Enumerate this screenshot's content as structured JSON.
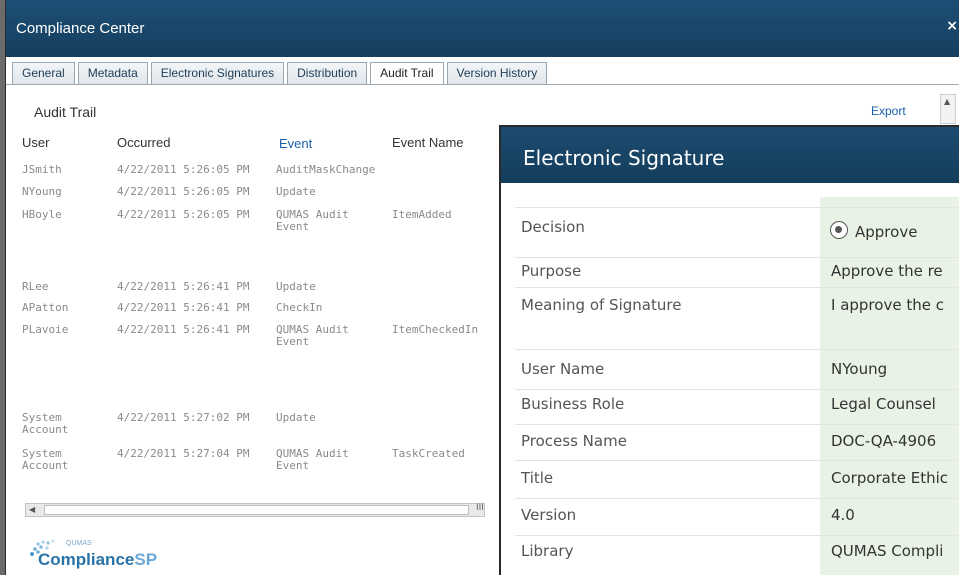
{
  "window": {
    "title": "Compliance Center",
    "close_label": "×"
  },
  "tabs": [
    {
      "label": "General"
    },
    {
      "label": "Metadata"
    },
    {
      "label": "Electronic Signatures"
    },
    {
      "label": "Distribution"
    },
    {
      "label": "Audit Trail"
    },
    {
      "label": "Version History"
    }
  ],
  "active_tab": "Audit Trail",
  "audit": {
    "title": "Audit Trail",
    "export_label": "Export",
    "columns": [
      "User",
      "Occurred",
      "Event",
      "Event Name"
    ],
    "rows": [
      {
        "user": "JSmith",
        "occurred": "4/22/2011 5:26:05 PM",
        "event": "AuditMaskChange",
        "event_name": ""
      },
      {
        "user": "NYoung",
        "occurred": "4/22/2011 5:26:05 PM",
        "event": "Update",
        "event_name": ""
      },
      {
        "user": "HBoyle",
        "occurred": "4/22/2011 5:26:05 PM",
        "event": "QUMAS Audit Event",
        "event_name": "ItemAdded"
      },
      {
        "user": "RLee",
        "occurred": "4/22/2011 5:26:41 PM",
        "event": "Update",
        "event_name": ""
      },
      {
        "user": "APatton",
        "occurred": "4/22/2011 5:26:41 PM",
        "event": "CheckIn",
        "event_name": ""
      },
      {
        "user": "PLavoie",
        "occurred": "4/22/2011 5:26:41 PM",
        "event": "QUMAS Audit Event",
        "event_name": "ItemCheckedIn"
      },
      {
        "user": "System Account",
        "occurred": "4/22/2011 5:27:02 PM",
        "event": "Update",
        "event_name": ""
      },
      {
        "user": "System Account",
        "occurred": "4/22/2011 5:27:04 PM",
        "event": "QUMAS Audit Event",
        "event_name": "TaskCreated"
      }
    ],
    "scroll_grip": "III"
  },
  "logo": {
    "small": "QUMAS",
    "brand_main": "Compliance",
    "brand_suffix": "SP"
  },
  "esig": {
    "title": "Electronic Signature",
    "fields": [
      {
        "label": "Decision",
        "value": "Approve"
      },
      {
        "label": "Purpose",
        "value": "Approve the re"
      },
      {
        "label": "Meaning of Signature",
        "value": "I approve the c"
      },
      {
        "label": "User Name",
        "value": "NYoung"
      },
      {
        "label": "Business Role",
        "value": "Legal Counsel"
      },
      {
        "label": "Process Name",
        "value": "DOC-QA-4906"
      },
      {
        "label": "Title",
        "value": "Corporate Ethic"
      },
      {
        "label": "Version",
        "value": "4.0"
      },
      {
        "label": "Library",
        "value": "QUMAS Compli"
      }
    ]
  },
  "colors": {
    "titlebar": "#1d4f74",
    "link": "#1a5fa8",
    "value_bg": "#e8f3e6"
  },
  "icons": {
    "close": "close-icon",
    "radio": "radio-selected-icon"
  }
}
